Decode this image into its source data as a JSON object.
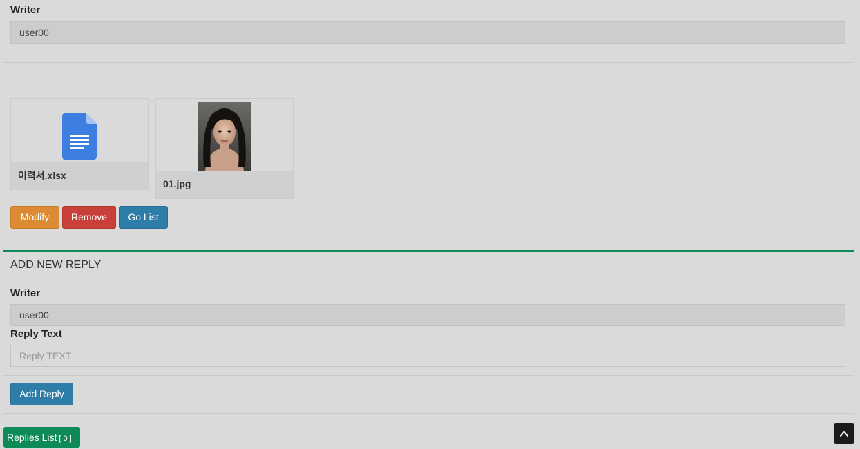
{
  "post": {
    "writer_label": "Writer",
    "writer_value": "user00"
  },
  "attachments": [
    {
      "name": "이력서.xlsx",
      "icon": "document-file-icon"
    },
    {
      "name": "01.jpg",
      "icon": "portrait-photo"
    }
  ],
  "actions": {
    "modify": "Modify",
    "remove": "Remove",
    "go_list": "Go List"
  },
  "reply_form": {
    "title": "ADD NEW REPLY",
    "writer_label": "Writer",
    "writer_value": "user00",
    "reply_text_label": "Reply Text",
    "reply_text_placeholder": "Reply TEXT",
    "add_button": "Add Reply"
  },
  "replies": {
    "label": "Replies List",
    "count": "[ 0 ]"
  },
  "colors": {
    "orange": "#db8b33",
    "red": "#c9403a",
    "blue": "#2e7da8",
    "green": "#0e8a57",
    "doc_icon": "#3d7fe0"
  }
}
